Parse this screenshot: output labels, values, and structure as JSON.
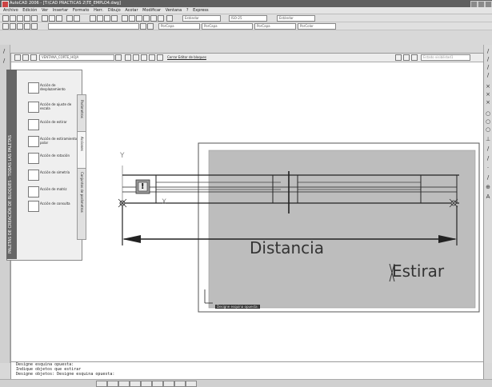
{
  "app": {
    "title": "AutoCAD 2006 - [T:\\CAD PRACTICAS 2\\TE_EMPLO4.dwg]"
  },
  "menu": [
    "Archivo",
    "Edición",
    "Ver",
    "Insertar",
    "Formato",
    "Herr.",
    "Dibujo",
    "Acotar",
    "Modificar",
    "Ventana",
    "?",
    "Express"
  ],
  "toolbar": {
    "layer_combo": "Estándar",
    "dim_combo": "ISO-25",
    "table_combo": "Estándar",
    "color_combo": "PorCapa",
    "linetype_combo": "PorCapa",
    "lineweight_combo": "PorCapa",
    "plot_combo": "PorColor"
  },
  "block_editor": {
    "block_name": "VENTANA_CORTE_HOJA",
    "close_label": "Cerrar Editor de bloques",
    "visibility_combo": "Estado visibilidad1"
  },
  "palette": {
    "strip_title": "PALETAS DE CREACIÓN DE BLOQUES - TODAS LAS PALETAS",
    "items": [
      {
        "label": "Acción de desplazamiento",
        "icon": "move-action-icon"
      },
      {
        "label": "Acción de ajuste de escala",
        "icon": "scale-action-icon"
      },
      {
        "label": "Acción de estirar",
        "icon": "stretch-action-icon"
      },
      {
        "label": "Acción de estiramiento polar",
        "icon": "polar-stretch-icon"
      },
      {
        "label": "Acción de rotación",
        "icon": "rotate-action-icon"
      },
      {
        "label": "Acción de simetría",
        "icon": "mirror-action-icon"
      },
      {
        "label": "Acción de matriz",
        "icon": "array-action-icon"
      },
      {
        "label": "Acción de consulta",
        "icon": "lookup-action-icon"
      }
    ],
    "tabs": [
      "Parámetros",
      "Acciones",
      "Conjuntos de parámetros"
    ]
  },
  "drawing": {
    "axis_y": "Y",
    "axis_x": "X",
    "distance_label": "Distancia",
    "stretch_label": "Estirar",
    "tooltip": "Designe esquina opuesta:",
    "warning_glyph": "!"
  },
  "command_line": [
    "Designe esquina opuesta:",
    "Indique objetos que estirar",
    "Designe objetos: Designe esquina opuesta:"
  ],
  "colors": {
    "titlebar": "#5f5f5f",
    "grey_rect": "#bdbdbd",
    "palette_strip": "#666666"
  }
}
